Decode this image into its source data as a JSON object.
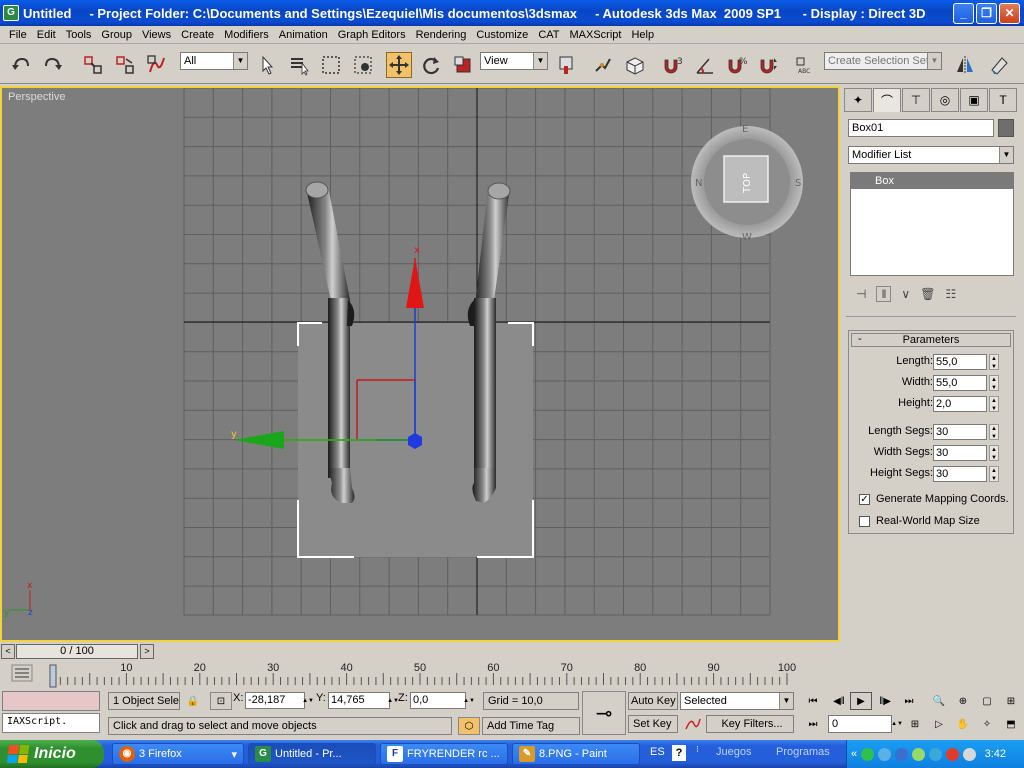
{
  "window": {
    "title": "Untitled     - Project Folder: C:\\Documents and Settings\\Ezequiel\\Mis documentos\\3dsmax     - Autodesk 3ds Max  2009 SP1      - Display : Direct 3D",
    "app_icon": "3dsmax-icon"
  },
  "menu": [
    "File",
    "Edit",
    "Tools",
    "Group",
    "Views",
    "Create",
    "Modifiers",
    "Animation",
    "Graph Editors",
    "Rendering",
    "Customize",
    "CAT",
    "MAXScript",
    "Help"
  ],
  "toolbar": {
    "selection_filter": "All",
    "reference_coord": "View",
    "named_selection_placeholder": "Create Selection Set",
    "snap_label": "3"
  },
  "viewport": {
    "label": "Perspective",
    "viewcube_face": "TOP",
    "compass": [
      "N",
      "E",
      "S",
      "W"
    ],
    "axis_x": "x",
    "axis_y": "y",
    "axis_z": "z",
    "accent_color": "#f2d33b"
  },
  "command_panel": {
    "object_name": "Box01",
    "object_color": "#6e6e6e",
    "modifier_list": "Modifier List",
    "stack_items": [
      "Box"
    ],
    "rollout_title": "Parameters",
    "params": [
      {
        "label": "Length:",
        "value": "55,0"
      },
      {
        "label": "Width:",
        "value": "55,0"
      },
      {
        "label": "Height:",
        "value": "2,0"
      },
      {
        "label": "Length Segs:",
        "value": "30"
      },
      {
        "label": "Width Segs:",
        "value": "30"
      },
      {
        "label": "Height Segs:",
        "value": "30"
      }
    ],
    "generate_mapping": {
      "label": "Generate Mapping Coords.",
      "checked": true
    },
    "real_world": {
      "label": "Real-World Map Size",
      "checked": false
    }
  },
  "timeline": {
    "frame_display": "0 / 100",
    "ticks": [
      "0",
      "10",
      "20",
      "30",
      "40",
      "50",
      "60",
      "70",
      "80",
      "90",
      "100"
    ]
  },
  "status": {
    "maxscript": "IAXScript.",
    "selection": "1 Object Sele",
    "x_label": "X:",
    "x_value": "-28,187",
    "y_label": "Y:",
    "y_value": "14,765",
    "z_label": "Z:",
    "z_value": "0,0",
    "grid": "Grid = 10,0",
    "prompt": "Click and drag to select and move objects",
    "add_time_tag": "Add Time Tag",
    "auto_key": "Auto Key",
    "set_key": "Set Key",
    "key_mode": "Selected",
    "key_filters": "Key Filters...",
    "current_frame": "0"
  },
  "taskbar": {
    "start": "Inicio",
    "tasks": [
      {
        "label": "3 Firefox",
        "icon": "firefox-icon"
      },
      {
        "label": "Untitled      - Pr...",
        "icon": "3dsmax-icon"
      },
      {
        "label": "FRYRENDER rc ...",
        "icon": "fryrender-icon"
      },
      {
        "label": "8.PNG - Paint",
        "icon": "paint-icon"
      }
    ],
    "lang": "ES",
    "juegos": "Juegos",
    "programas": "Programas",
    "clock": "3:42"
  }
}
